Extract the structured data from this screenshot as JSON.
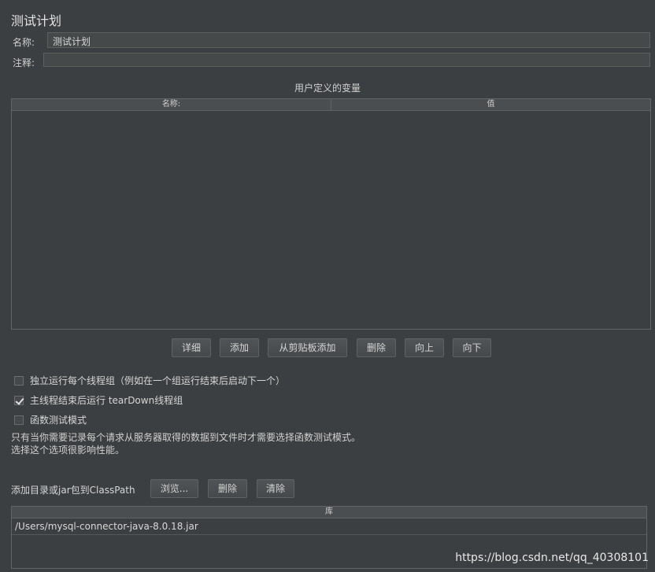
{
  "header": {
    "title": "测试计划"
  },
  "form": {
    "name_label": "名称:",
    "name_value": "测试计划",
    "comment_label": "注释:",
    "comment_value": ""
  },
  "variables": {
    "title": "用户定义的变量",
    "columns": [
      "名称:",
      "值"
    ]
  },
  "buttons": {
    "detail": "详细",
    "add": "添加",
    "add_clipboard": "从剪贴板添加",
    "delete": "删除",
    "up": "向上",
    "down": "向下"
  },
  "options": [
    {
      "label": "独立运行每个线程组（例如在一个组运行结束后启动下一个）",
      "checked": false
    },
    {
      "label": "主线程结束后运行 tearDown线程组",
      "checked": true
    },
    {
      "label": "函数测试模式",
      "checked": false
    }
  ],
  "note": {
    "line1": "只有当你需要记录每个请求从服务器取得的数据到文件时才需要选择函数测试模式。",
    "line2": "选择这个选项很影响性能。"
  },
  "classpath": {
    "label": "添加目录或jar包到ClassPath",
    "browse": "浏览...",
    "delete": "删除",
    "clear": "清除",
    "column": "库",
    "rows": [
      "/Users/mysql-connector-java-8.0.18.jar"
    ]
  },
  "watermark": "https://blog.csdn.net/qq_40308101"
}
